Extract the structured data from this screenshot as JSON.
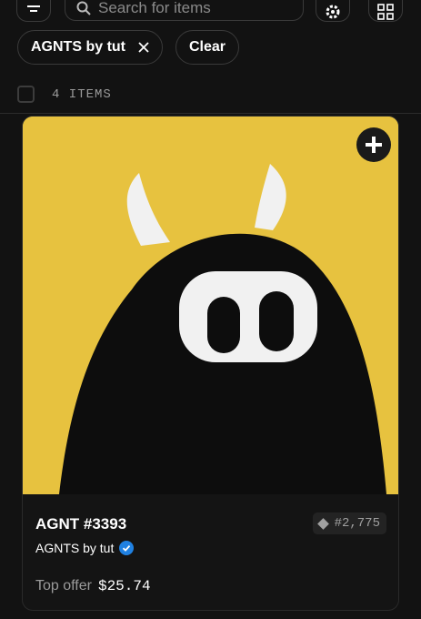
{
  "search": {
    "placeholder": "Search for items"
  },
  "filters": {
    "chips": [
      {
        "label": "AGNTS by tut"
      }
    ],
    "clear_label": "Clear"
  },
  "results": {
    "count_label": "4 ITEMS"
  },
  "card": {
    "name": "AGNT #3393",
    "rank": "#2,775",
    "collection": "AGNTS by tut",
    "verified": true,
    "offer_label": "Top offer",
    "offer_value": "$25.74",
    "image_background": "#e7c23f"
  },
  "icons": [
    "filter-icon",
    "search-icon",
    "settings-icon",
    "grid-view-icon",
    "close-icon",
    "plus-icon",
    "diamond-icon",
    "verified-icon"
  ]
}
